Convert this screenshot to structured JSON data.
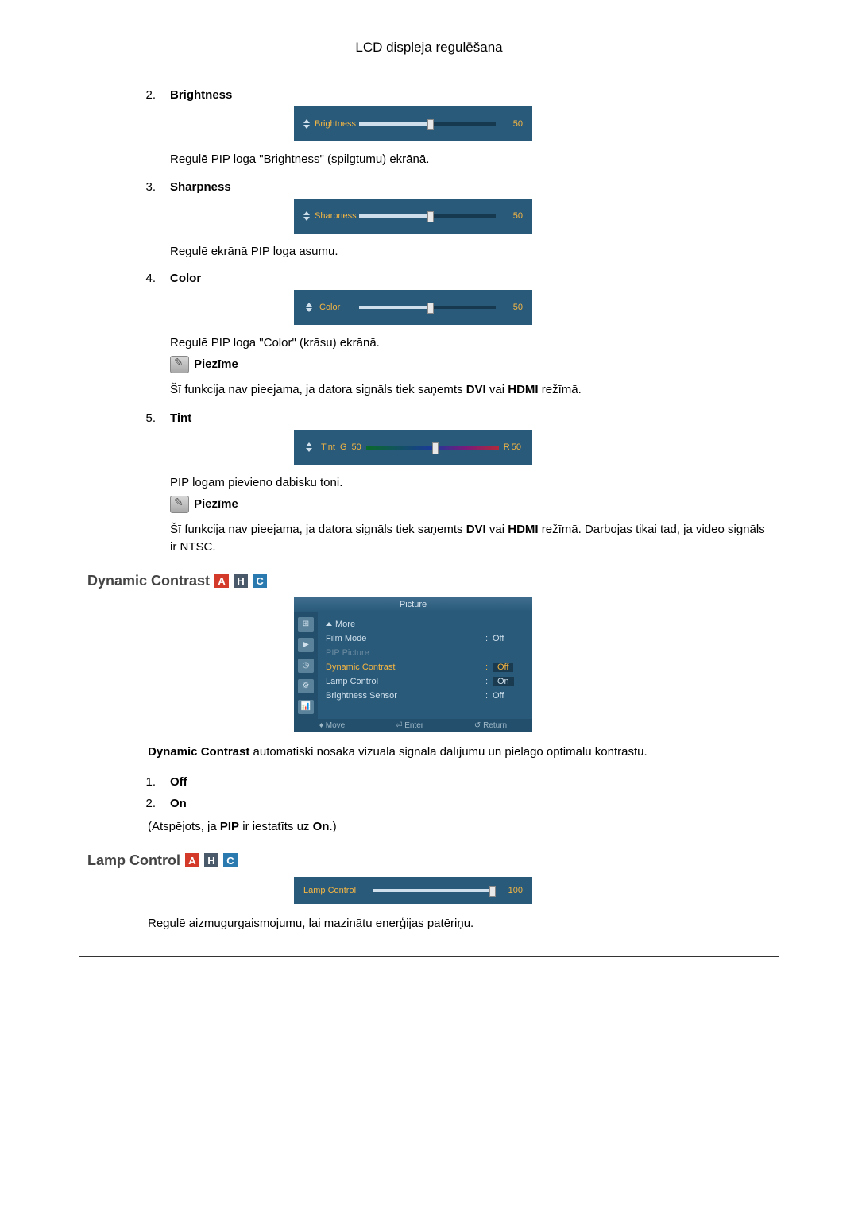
{
  "header": {
    "title": "LCD displeja regulēšana"
  },
  "items": {
    "brightness": {
      "num": "2.",
      "label": "Brightness",
      "slider_label": "Brightness",
      "slider_value": "50",
      "desc": "Regulē PIP loga \"Brightness\" (spilgtumu) ekrānā."
    },
    "sharpness": {
      "num": "3.",
      "label": "Sharpness",
      "slider_label": "Sharpness",
      "slider_value": "50",
      "desc": "Regulē ekrānā PIP loga asumu."
    },
    "color": {
      "num": "4.",
      "label": "Color",
      "slider_label": "Color",
      "slider_value": "50",
      "desc": "Regulē PIP loga \"Color\" (krāsu) ekrānā.",
      "note_label": "Piezīme",
      "note_body_pre": "Šī funkcija nav pieejama, ja datora signāls tiek saņemts ",
      "note_body_dvi": "DVI",
      "note_body_mid": " vai ",
      "note_body_hdmi": "HDMI",
      "note_body_post": " režīmā."
    },
    "tint": {
      "num": "5.",
      "label": "Tint",
      "slider_label": "Tint",
      "g_label": "G",
      "g_value": "50",
      "r_label": "R",
      "r_value": "50",
      "desc": "PIP logam pievieno dabisku toni.",
      "note_label": "Piezīme",
      "note_body_pre": "Šī funkcija nav pieejama, ja datora signāls tiek saņemts ",
      "note_body_dvi": "DVI",
      "note_body_mid": " vai ",
      "note_body_hdmi": "HDMI",
      "note_body_post": " režīmā. Darbojas tikai tad, ja video signāls ir NTSC."
    }
  },
  "dynamic_contrast": {
    "heading": "Dynamic Contrast",
    "badge_a": "A",
    "badge_h": "H",
    "badge_c": "C",
    "menu": {
      "title": "Picture",
      "more": "More",
      "rows": [
        {
          "label": "Film Mode",
          "value": "Off",
          "type": "normal"
        },
        {
          "label": "PIP Picture",
          "value": "",
          "type": "muted"
        },
        {
          "label": "Dynamic Contrast",
          "value": "Off",
          "type": "highlight"
        },
        {
          "label": "Lamp Control",
          "value": "On",
          "type": "hlval"
        },
        {
          "label": "Brightness Sensor",
          "value": "Off",
          "type": "normal"
        }
      ],
      "footer": {
        "move": "Move",
        "enter": "Enter",
        "return": "Return"
      }
    },
    "desc_pre": "Dynamic Contrast",
    "desc_post": " automātiski nosaka vizuālā signāla dalījumu un pielāgo optimālu kontrastu.",
    "opts": {
      "off_num": "1.",
      "off_label": "Off",
      "on_num": "2.",
      "on_label": "On"
    },
    "disabled_pre": "(Atspējots, ja ",
    "disabled_pip": "PIP",
    "disabled_mid": " ir iestatīts uz ",
    "disabled_on": "On",
    "disabled_post": ".)"
  },
  "lamp_control": {
    "heading": "Lamp Control",
    "badge_a": "A",
    "badge_h": "H",
    "badge_c": "C",
    "slider_label": "Lamp Control",
    "slider_value": "100",
    "desc": "Regulē aizmugurgaismojumu, lai mazinātu enerģijas patēriņu."
  }
}
